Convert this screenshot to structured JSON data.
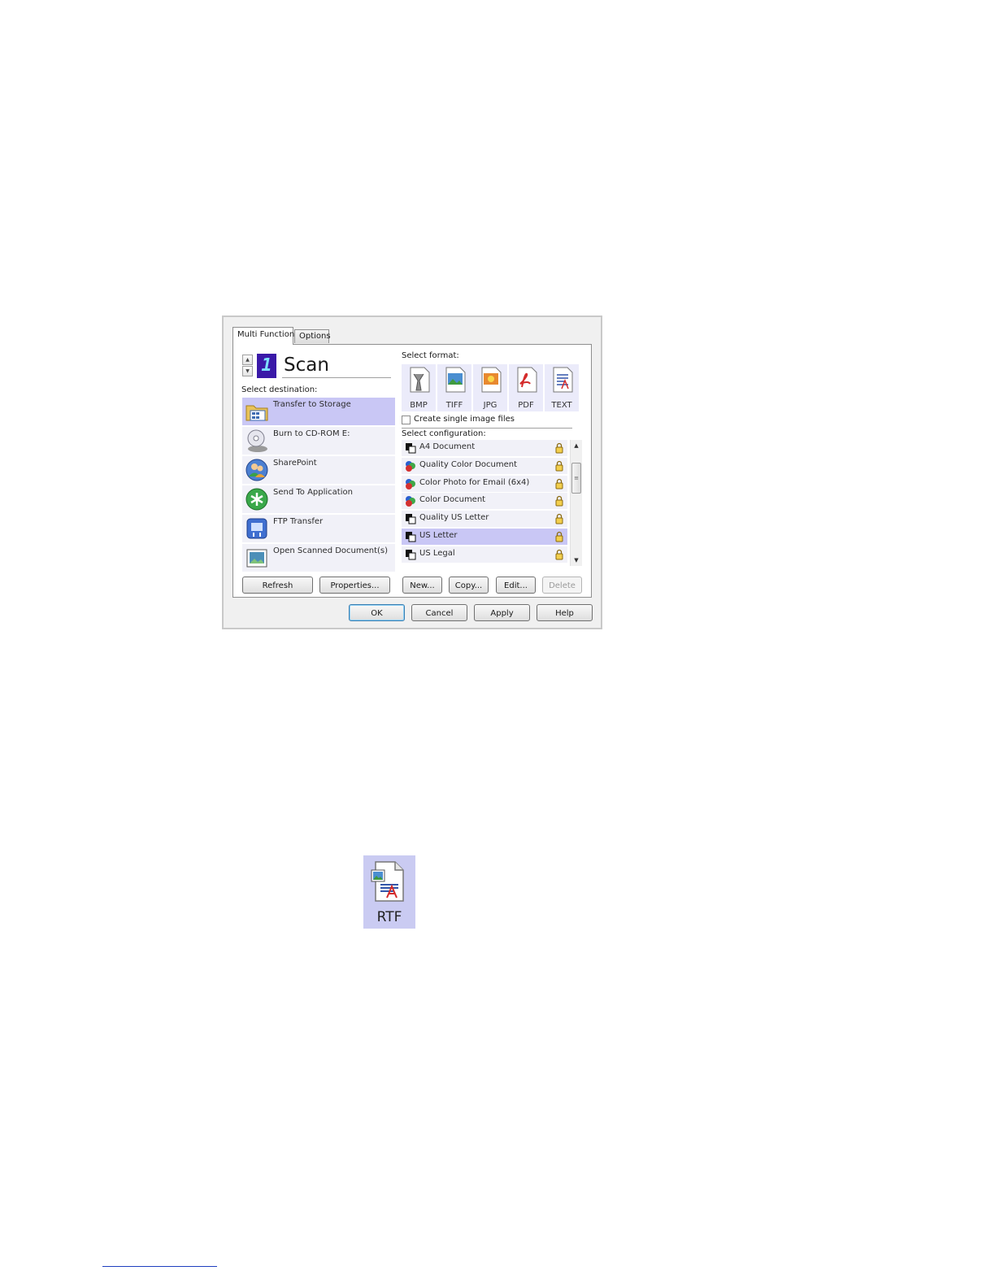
{
  "dialog": {
    "tabs": [
      {
        "label": "Multi Function"
      },
      {
        "label": "Options"
      }
    ],
    "mode": {
      "digit": "1",
      "title": "Scan"
    },
    "destination": {
      "label": "Select destination:",
      "items": [
        {
          "label": "Transfer to Storage",
          "icon": "folder-icon",
          "selected": true
        },
        {
          "label": "Burn to CD-ROM  E:",
          "icon": "cd-rom-icon",
          "selected": false
        },
        {
          "label": "SharePoint",
          "icon": "sharepoint-icon",
          "selected": false
        },
        {
          "label": "Send To Application",
          "icon": "send-to-application-icon",
          "selected": false
        },
        {
          "label": "FTP Transfer",
          "icon": "ftp-icon",
          "selected": false
        },
        {
          "label": "Open Scanned Document(s)",
          "icon": "open-document-icon",
          "selected": false
        }
      ],
      "refresh_label": "Refresh",
      "properties_label": "Properties..."
    },
    "format": {
      "label": "Select format:",
      "items": [
        {
          "label": "BMP",
          "icon": "bmp-icon"
        },
        {
          "label": "TIFF",
          "icon": "tiff-icon"
        },
        {
          "label": "JPG",
          "icon": "jpg-icon"
        },
        {
          "label": "PDF",
          "icon": "pdf-icon"
        },
        {
          "label": "TEXT",
          "icon": "text-icon"
        }
      ],
      "single_image_label": "Create single image files",
      "single_image_checked": false
    },
    "configuration": {
      "label": "Select configuration:",
      "items": [
        {
          "label": "A4 Document",
          "icon": "bw-document-icon",
          "selected": false
        },
        {
          "label": "Quality Color Document",
          "icon": "color-document-icon",
          "selected": false
        },
        {
          "label": "Color Photo for Email (6x4)",
          "icon": "color-document-icon",
          "selected": false
        },
        {
          "label": "Color Document",
          "icon": "color-document-icon",
          "selected": false
        },
        {
          "label": "Quality US Letter",
          "icon": "bw-document-icon",
          "selected": false
        },
        {
          "label": "US Letter",
          "icon": "bw-document-icon",
          "selected": true
        },
        {
          "label": "US Legal",
          "icon": "bw-document-icon",
          "selected": false
        }
      ],
      "new_label": "New...",
      "copy_label": "Copy...",
      "edit_label": "Edit...",
      "delete_label": "Delete"
    },
    "footer": {
      "ok_label": "OK",
      "cancel_label": "Cancel",
      "apply_label": "Apply",
      "help_label": "Help"
    }
  },
  "rtf_tile": {
    "label": "RTF",
    "icon": "rtf-icon"
  },
  "colors": {
    "selection": "#c9c7f5",
    "list_bg": "#f1f1f8",
    "tile_bg": "#cacbf2",
    "link_underline": "#1f3fbf"
  }
}
